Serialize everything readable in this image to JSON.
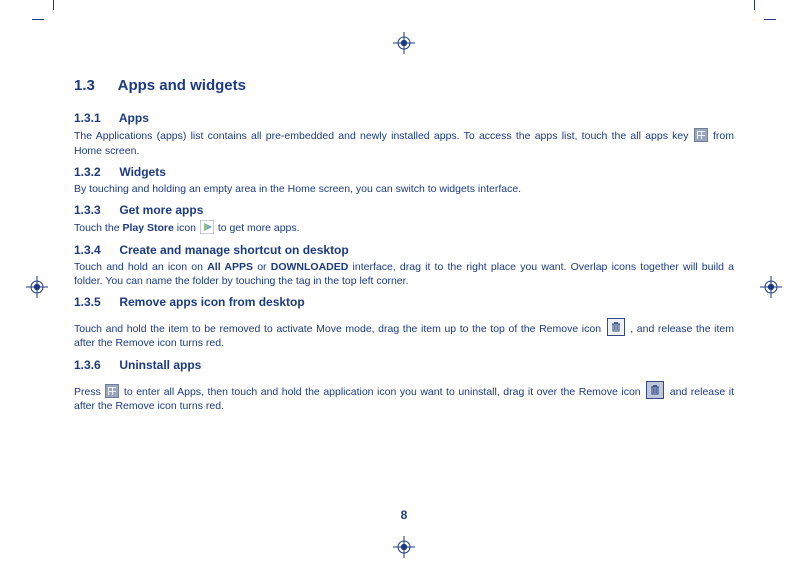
{
  "page_number": "8",
  "section": {
    "num": "1.3",
    "title": "Apps and widgets"
  },
  "subs": {
    "s1": {
      "num": "1.3.1",
      "title": "Apps",
      "text_a": "The Applications (apps) list contains all pre-embedded and newly installed apps. To access the apps list, touch the all apps key ",
      "text_b": " from Home screen."
    },
    "s2": {
      "num": "1.3.2",
      "title": "Widgets",
      "text": "By touching and holding an empty area in the Home screen,  you can switch to widgets interface."
    },
    "s3": {
      "num": "1.3.3",
      "title": "Get more apps",
      "text_a": "Touch the ",
      "text_bold": "Play Store",
      "text_b": " icon ",
      "text_c": " to get more apps."
    },
    "s4": {
      "num": "1.3.4",
      "title": "Create and manage shortcut on desktop",
      "text_a": "Touch and hold an icon on ",
      "b1": "All APPS",
      "mid": " or ",
      "b2": "DOWNLOADED",
      "text_b": " interface, drag it to the right place you want. Overlap icons together will build a folder. You can name the folder by touching the tag in the top left corner."
    },
    "s5": {
      "num": "1.3.5",
      "title": "Remove apps icon from desktop",
      "text_a": "Touch and hold the item to be removed to activate Move mode, drag the item up to the top of the Remove icon ",
      "text_b": " , and release the item after the Remove icon turns red."
    },
    "s6": {
      "num": "1.3.6",
      "title": "Uninstall apps",
      "text_a": "Press ",
      "text_b": " to enter all Apps, then touch and hold the application icon you want to uninstall, drag it over the Remove icon ",
      "text_c": " and release it after the Remove icon turns red."
    }
  }
}
